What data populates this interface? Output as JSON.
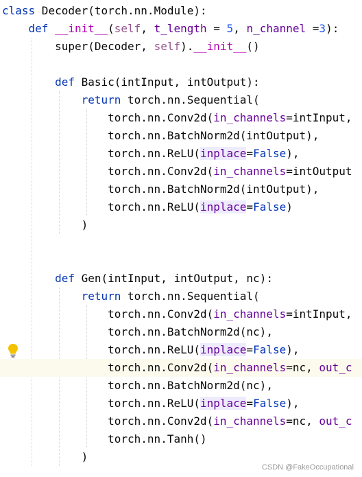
{
  "editor": {
    "language": "python",
    "lines": [
      "class Decoder(torch.nn.Module):",
      "    def __init__(self, t_length = 5, n_channel =3):",
      "        super(Decoder, self).__init__()",
      "",
      "        def Basic(intInput, intOutput):",
      "            return torch.nn.Sequential(",
      "                torch.nn.Conv2d(in_channels=intInput,",
      "                torch.nn.BatchNorm2d(intOutput),",
      "                torch.nn.ReLU(inplace=False),",
      "                torch.nn.Conv2d(in_channels=intOutput",
      "                torch.nn.BatchNorm2d(intOutput),",
      "                torch.nn.ReLU(inplace=False)",
      "            )",
      "",
      "",
      "        def Gen(intInput, intOutput, nc):",
      "            return torch.nn.Sequential(",
      "                torch.nn.Conv2d(in_channels=intInput,",
      "                torch.nn.BatchNorm2d(nc),",
      "                torch.nn.ReLU(inplace=False),",
      "                torch.nn.Conv2d(in_channels=nc, out_c",
      "                torch.nn.BatchNorm2d(nc),",
      "                torch.nn.ReLU(inplace=False),",
      "                torch.nn.Conv2d(in_channels=nc, out_c",
      "                torch.nn.Tanh()",
      "            )"
    ],
    "current_line": 20,
    "gutter_icon": "lightbulb-icon",
    "colors": {
      "keyword": "#0033b3",
      "parameter": "#660099",
      "self": "#94558d",
      "number": "#1750eb",
      "dunder": "#b200b2",
      "selection": "#a6d2ff",
      "current_line": "#fcfaed",
      "usage_highlight": "#edebfc"
    }
  },
  "watermark": "CSDN @FakeOccupational"
}
